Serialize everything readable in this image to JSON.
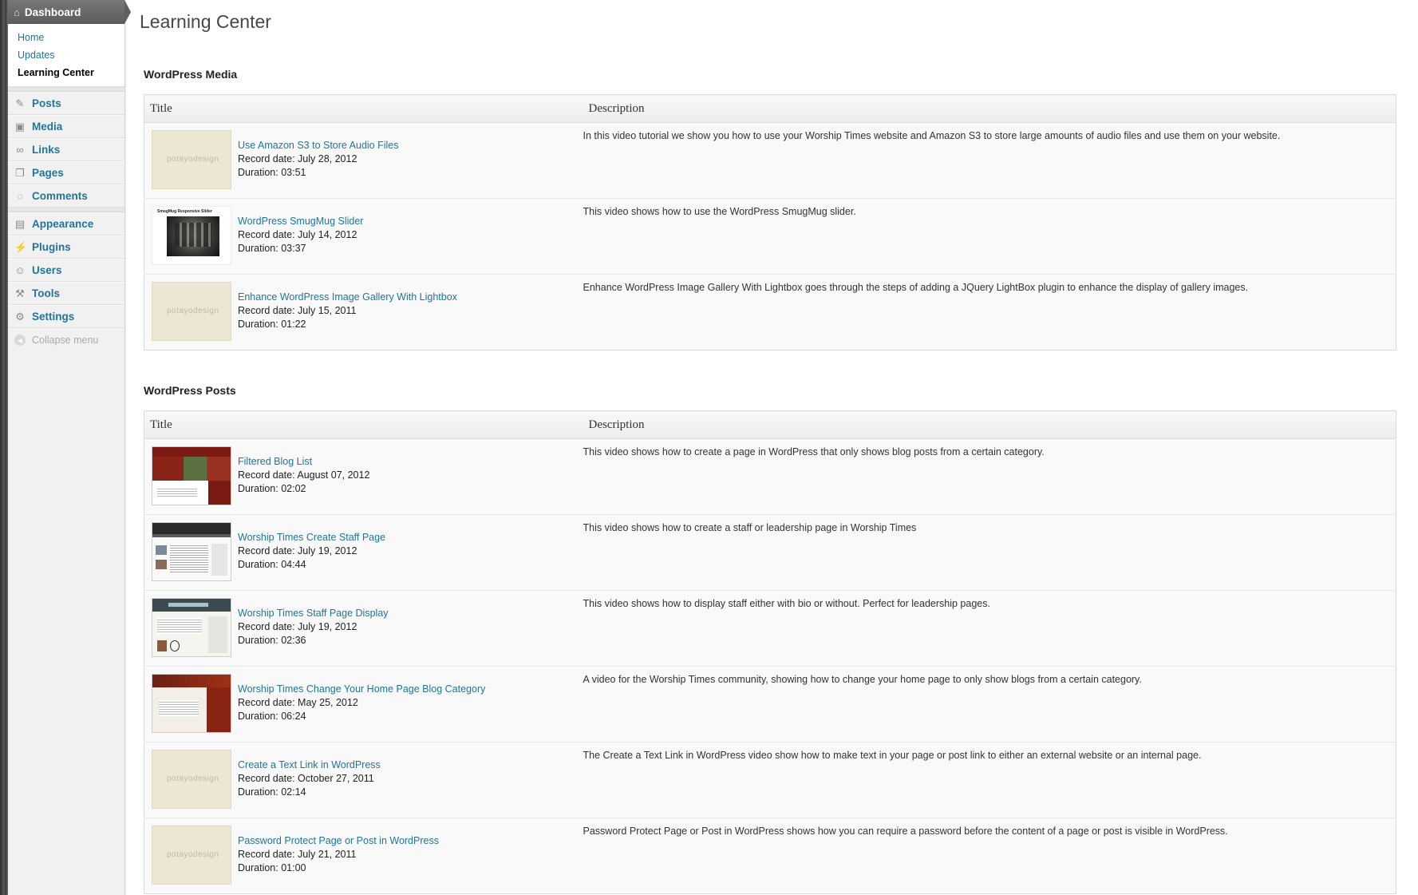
{
  "sidebar": {
    "dashboard": "Dashboard",
    "submenu": [
      "Home",
      "Updates",
      "Learning Center"
    ],
    "group1": [
      "Posts",
      "Media",
      "Links",
      "Pages",
      "Comments"
    ],
    "group2": [
      "Appearance",
      "Plugins",
      "Users",
      "Tools",
      "Settings"
    ],
    "collapse": "Collapse menu"
  },
  "page_title": "Learning Center",
  "sections": [
    {
      "heading": "WordPress Media",
      "col_title": "Title",
      "col_description": "Description",
      "rows": [
        {
          "title": "Use Amazon S3 to Store Audio Files",
          "record": "Record date: July 28, 2012",
          "duration": "Duration: 03:51",
          "description": "In this video tutorial we show you how to use your Worship Times website and Amazon S3 to store large amounts of audio files and use them on your website."
        },
        {
          "title": "WordPress SmugMug Slider",
          "record": "Record date: July 14, 2012",
          "duration": "Duration: 03:37",
          "description": "This video shows how to use the WordPress SmugMug slider."
        },
        {
          "title": "Enhance WordPress Image Gallery With Lightbox",
          "record": "Record date: July 15, 2011",
          "duration": "Duration: 01:22",
          "description": "Enhance WordPress Image Gallery With Lightbox goes through the steps of adding a JQuery LightBox plugin to enhance the display of gallery images."
        }
      ]
    },
    {
      "heading": "WordPress Posts",
      "col_title": "Title",
      "col_description": "Description",
      "rows": [
        {
          "title": "Filtered Blog List",
          "record": "Record date: August 07, 2012",
          "duration": "Duration: 02:02",
          "description": "This video shows how to create a page in WordPress that only shows blog posts from a certain category."
        },
        {
          "title": "Worship Times Create Staff Page",
          "record": "Record date: July 19, 2012",
          "duration": "Duration: 04:44",
          "description": "This video shows how to create a staff or leadership page in Worship Times"
        },
        {
          "title": "Worship Times Staff Page Display",
          "record": "Record date: July 19, 2012",
          "duration": "Duration: 02:36",
          "description": "This video shows how to display staff either with bio or without. Perfect for leadership pages."
        },
        {
          "title": "Worship Times Change Your Home Page Blog Category",
          "record": "Record date: May 25, 2012",
          "duration": "Duration: 06:24",
          "description": "A video for the Worship Times community, showing how to change your home page to only show blogs from a certain category."
        },
        {
          "title": "Create a Text Link in WordPress",
          "record": "Record date: October 27, 2011",
          "duration": "Duration: 02:14",
          "description": "The Create a Text Link in WordPress video show how to make text in your page or post link to either an external website or an internal page."
        },
        {
          "title": "Password Protect Page or Post in WordPress",
          "record": "Record date: July 21, 2011",
          "duration": "Duration: 01:00",
          "description": "Password Protect Page or Post in WordPress shows how you can require a password before the content of a page or post is visible in WordPress."
        }
      ]
    }
  ],
  "thumb_watermark": "potayodesign",
  "thumb_slider_caption": "SmugMug Responsive Slider"
}
